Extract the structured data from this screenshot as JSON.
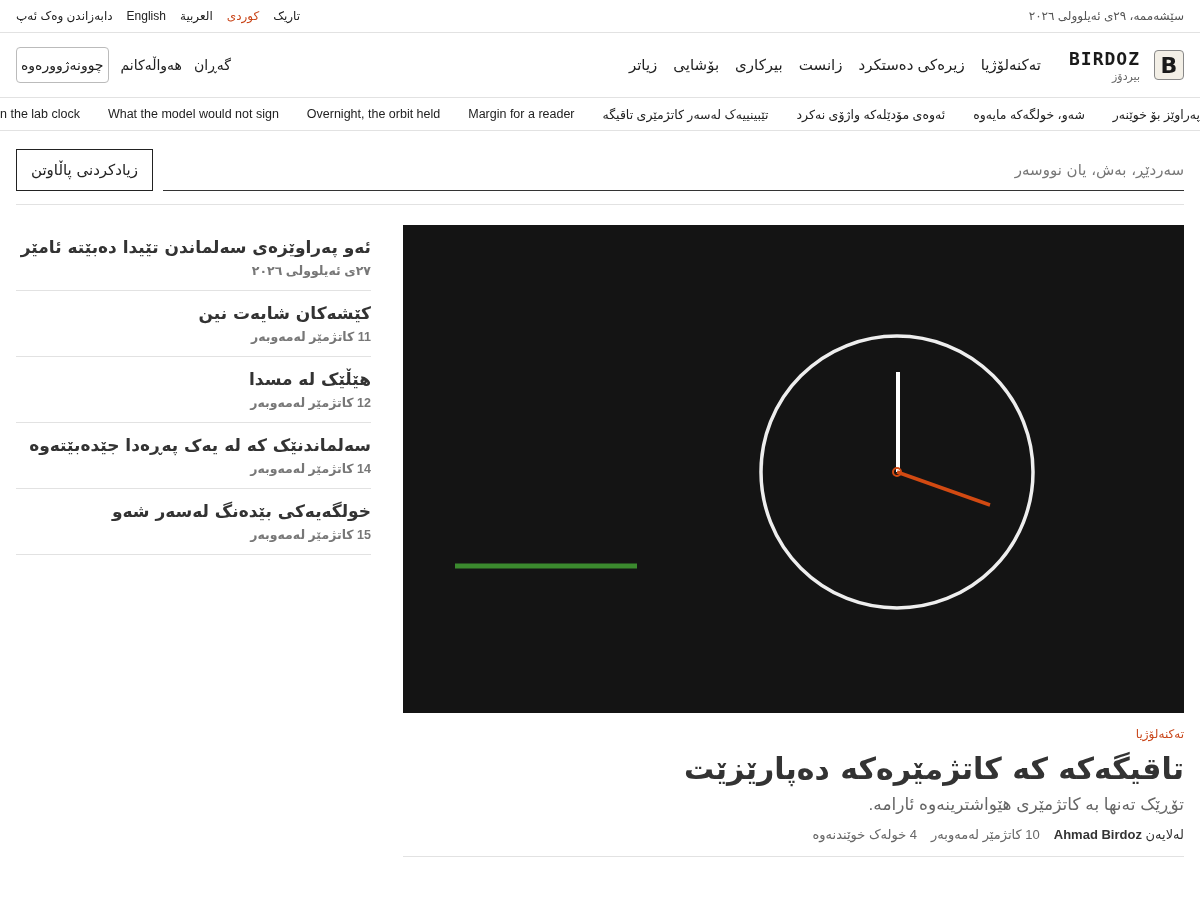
{
  "topbar": {
    "date": "سێشەممە، ٢٩ی ئەیلوولی ٢٠٢٦",
    "theme_toggle": "تاریک",
    "languages": [
      {
        "label": "کوردی",
        "selected": true
      },
      {
        "label": "العربية",
        "selected": false
      },
      {
        "label": "English",
        "selected": false
      }
    ],
    "install_link": "دابەزاندن وەک ئەپ"
  },
  "header": {
    "logo_mark": "B",
    "logo_name": "BIRDOZ",
    "logo_subtitle": "بیردۆز",
    "nav": [
      "تەکنەلۆژیا",
      "زیرەکی دەستکرد",
      "زانست",
      "بیرکاری",
      "بۆشایی",
      "زیاتر"
    ],
    "search_link": "گەڕان",
    "my_news_link": "هەواڵەکانم",
    "login_button": "چوونەژوورەوە"
  },
  "ticker": [
    "پەراوێز بۆ خوێنەر",
    "شەو، خولگەکە مایەوە",
    "ئەوەی مۆدێلەکە واژۆی نەکرد",
    "تێبینییەک لەسەر کاتژمێری تاقیگە",
    "Margin for a reader",
    "Overnight, the orbit held",
    "What the model would not sign",
    "n the lab clock"
  ],
  "search": {
    "placeholder": "سەردێڕ، بەش، یان نووسەر",
    "filter_button": "زیادکردنی پاڵاوتن"
  },
  "lead_story": {
    "category": "تەکنەلۆژیا",
    "title": "تاقیگەکە کە کاتژمێرەکە دەپارێزێت",
    "dek": "تۆڕێک تەنها بە کاتژمێری هێواشترینەوە ئارامە.",
    "byline": "لەلایەن **Ahmad Birdoz**",
    "time": "10 کاتژمێر لەمەوبەر",
    "read_time": "4 خولەک خوێندنەوە"
  },
  "side_stories": [
    {
      "title": "ئەو پەراوێزەی سەلماندن تێیدا دەبێتە ئامێر",
      "time": "٢٧ی ئەیلوولی ٢٠٢٦"
    },
    {
      "title": "کێشەکان شایەت نین",
      "time": "11 کاتژمێر لەمەوبەر"
    },
    {
      "title": "هێڵێک لە مسدا",
      "time": "12 کاتژمێر لەمەوبەر"
    },
    {
      "title": "سەلماندنێک کە لە یەک پەڕەدا جێدەبێتەوە",
      "time": "14 کاتژمێر لەمەوبەر"
    },
    {
      "title": "خولگەیەکی بێدەنگ لەسەر شەو",
      "time": "15 کاتژمێر لەمەوبەر"
    }
  ]
}
